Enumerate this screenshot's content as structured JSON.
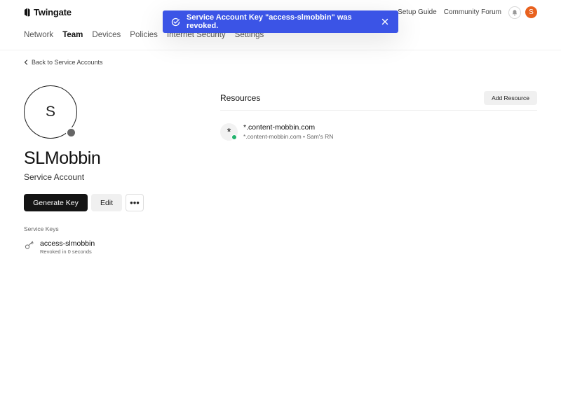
{
  "header": {
    "logo_text": "Twingate",
    "links": [
      "Setup Guide",
      "Community Forum"
    ],
    "user_initial": "S",
    "avatar_color": "#e8611e"
  },
  "nav": {
    "tabs": [
      "Network",
      "Team",
      "Devices",
      "Policies",
      "Internet Security",
      "Settings"
    ],
    "active": "Team"
  },
  "toast": {
    "message": "Service Account Key \"access-slmobbin\" was revoked.",
    "color": "#3b54e6",
    "icon": "check-circle-icon"
  },
  "back_link": "Back to Service Accounts",
  "profile": {
    "initial": "S",
    "name": "SLMobbin",
    "type": "Service Account",
    "status_color": "#666666"
  },
  "actions": {
    "generate_label": "Generate Key",
    "edit_label": "Edit",
    "more_label": "•••"
  },
  "service_keys": {
    "heading": "Service Keys",
    "items": [
      {
        "name": "access-slmobbin",
        "status": "Revoked in 0 seconds"
      }
    ]
  },
  "resources": {
    "heading": "Resources",
    "add_label": "Add Resource",
    "items": [
      {
        "icon": "*",
        "name": "*.content-mobbin.com",
        "detail": "*.content-mobbin.com • Sam's RN",
        "status_color": "#23b26d"
      }
    ]
  }
}
